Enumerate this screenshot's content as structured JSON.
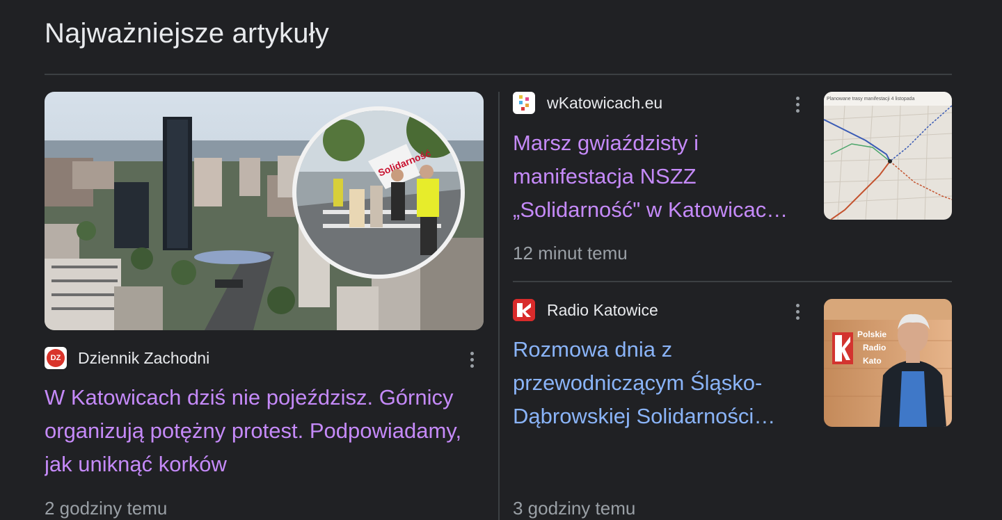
{
  "section": {
    "title": "Najważniejsze artykuły"
  },
  "lead": {
    "source": "Dziennik Zachodni",
    "favicon_text": "DZ",
    "favicon_color": "#d9342b",
    "headline": "W Katowicach dziś nie pojeździsz. Górnicy organizują potężny protest. Podpowiadamy, jak uniknąć korków",
    "time": "2 godziny temu",
    "image_icon": "city-skyline-with-protest-inset"
  },
  "articles": [
    {
      "source": "wKatowicach.eu",
      "headline": "Marsz gwiaździsty i manifestacja NSZZ „Solidarność\" w Katowicac…",
      "time": "12 minut temu",
      "thumb_icon": "street-map-thumbnail",
      "thumb_caption": "Planowane trasy manifestacji 4 listopada"
    },
    {
      "source": "Radio Katowice",
      "headline": "Rozmowa dnia z przewodniczącym Śląsko-Dąbrowskiej Solidarności…",
      "time": "3 godziny temu",
      "thumb_icon": "person-in-studio-thumbnail",
      "thumb_sign": "Polskie Radio Kato",
      "favicon_color": "#d92b2b"
    }
  ],
  "colors": {
    "background": "#202124",
    "visited_link": "#c58af9",
    "link": "#8ab4f8",
    "muted": "#9aa0a6"
  }
}
